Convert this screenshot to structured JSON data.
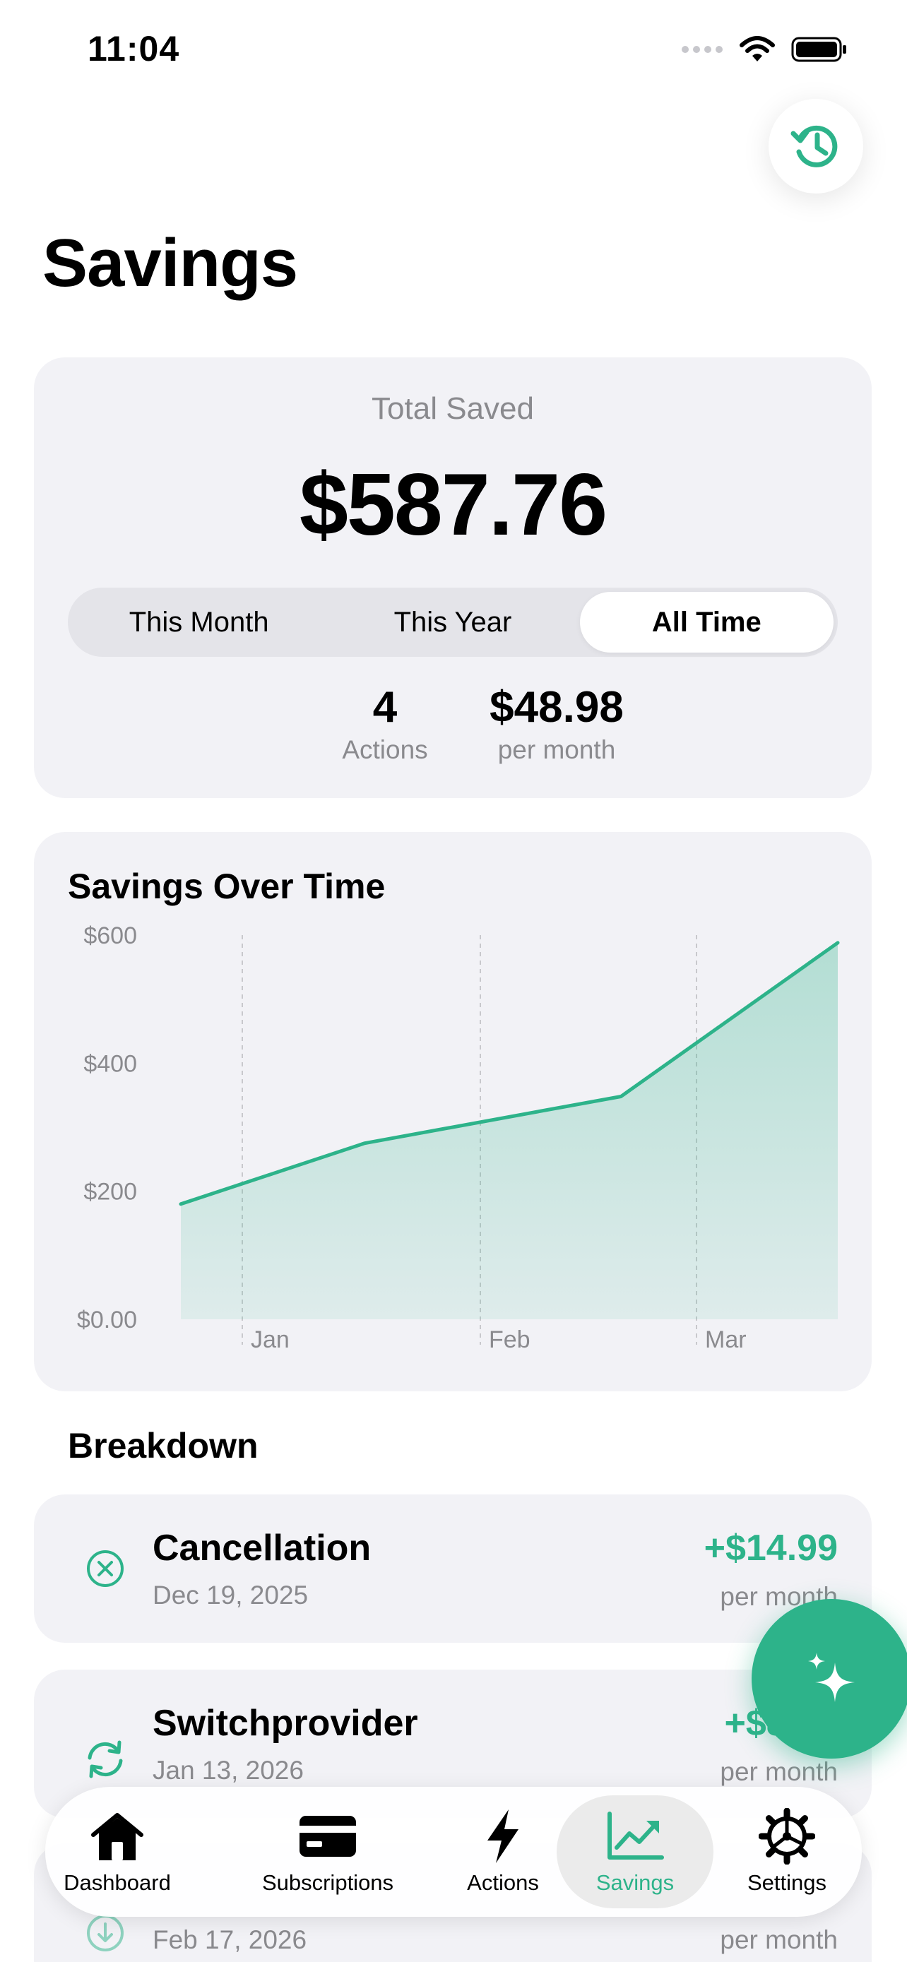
{
  "status_bar": {
    "time": "11:04"
  },
  "header": {
    "title": "Savings"
  },
  "summary": {
    "label": "Total Saved",
    "total": "$587.76",
    "periods": [
      "This Month",
      "This Year",
      "All Time"
    ],
    "selected_period": "All Time",
    "actions_count": "4",
    "actions_label": "Actions",
    "monthly_value": "$48.98",
    "monthly_label": "per month"
  },
  "chart": {
    "title": "Savings Over Time"
  },
  "chart_data": {
    "type": "area",
    "title": "Savings Over Time",
    "y_ticks": [
      "$600",
      "$400",
      "$200",
      "$0.00"
    ],
    "x_ticks": [
      "Jan",
      "Feb",
      "Mar"
    ],
    "x": [
      "Dec 19, 2025",
      "Jan 13, 2026",
      "Feb 17, 2026",
      "Mar 2026"
    ],
    "series": [
      {
        "values": [
          180,
          275,
          348,
          588
        ]
      }
    ],
    "ylim": [
      0,
      600
    ],
    "grid": "vertical dashed",
    "color": "#2db38a"
  },
  "breakdown": {
    "title": "Breakdown",
    "items": [
      {
        "title": "Cancellation",
        "date": "Dec 19, 2025",
        "amount": "+$14.99",
        "period": "per month",
        "icon": "x-circle-icon"
      },
      {
        "title": "Switchprovider",
        "date": "Jan 13, 2026",
        "amount": "+$8.00",
        "period": "per month",
        "icon": "refresh-icon"
      },
      {
        "title": "",
        "date": "Feb 17, 2026",
        "amount": "",
        "period": "per month",
        "icon": "download-icon"
      }
    ]
  },
  "tabs": [
    {
      "label": "Dashboard",
      "icon": "house-icon"
    },
    {
      "label": "Subscriptions",
      "icon": "credit-card-icon"
    },
    {
      "label": "Actions",
      "icon": "bolt-icon"
    },
    {
      "label": "Savings",
      "icon": "chart-line-icon",
      "active": true
    },
    {
      "label": "Settings",
      "icon": "gear-icon"
    }
  ],
  "colors": {
    "accent": "#2db38a",
    "card_bg": "#f2f2f6",
    "secondary_text": "#8a8a8e"
  }
}
